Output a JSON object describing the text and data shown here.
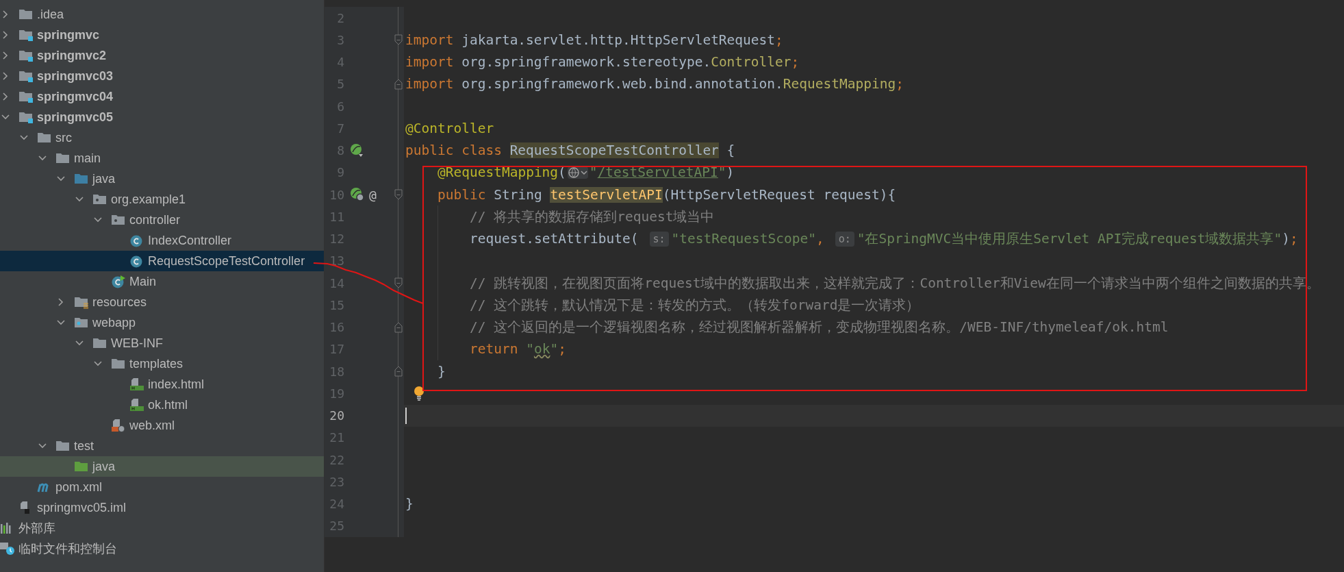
{
  "project_tree": {
    "items": [
      {
        "kind": "folder",
        "label": ".idea",
        "expanded": false,
        "selected": false,
        "highlighted": false
      },
      {
        "kind": "module",
        "label": "springmvc",
        "expanded": false,
        "selected": false,
        "highlighted": false
      },
      {
        "kind": "module",
        "label": "springmvc2",
        "expanded": false,
        "selected": false,
        "highlighted": false
      },
      {
        "kind": "module",
        "label": "springmvc03",
        "expanded": false,
        "selected": false,
        "highlighted": false
      },
      {
        "kind": "module",
        "label": "springmvc04",
        "expanded": false,
        "selected": false,
        "highlighted": false
      },
      {
        "kind": "module",
        "label": "springmvc05",
        "expanded": true,
        "selected": false,
        "highlighted": false,
        "children": [
          {
            "kind": "folder",
            "label": "src",
            "expanded": true,
            "selected": false,
            "highlighted": false,
            "children": [
              {
                "kind": "folder",
                "label": "main",
                "expanded": true,
                "selected": false,
                "highlighted": false,
                "children": [
                  {
                    "kind": "source-folder",
                    "label": "java",
                    "expanded": true,
                    "selected": false,
                    "highlighted": false,
                    "children": [
                      {
                        "kind": "package",
                        "label": "org.example1",
                        "expanded": true,
                        "selected": false,
                        "highlighted": false,
                        "children": [
                          {
                            "kind": "package",
                            "label": "controller",
                            "expanded": true,
                            "selected": false,
                            "highlighted": false,
                            "children": [
                              {
                                "kind": "class",
                                "label": "IndexController",
                                "selected": false,
                                "highlighted": false
                              },
                              {
                                "kind": "class",
                                "label": "RequestScopeTestController",
                                "selected": true,
                                "highlighted": false
                              }
                            ]
                          },
                          {
                            "kind": "main-class",
                            "label": "Main",
                            "selected": false,
                            "highlighted": false
                          }
                        ]
                      }
                    ]
                  },
                  {
                    "kind": "resources-folder",
                    "label": "resources",
                    "expanded": false,
                    "selected": false,
                    "highlighted": false
                  },
                  {
                    "kind": "web-folder",
                    "label": "webapp",
                    "expanded": true,
                    "selected": false,
                    "highlighted": false,
                    "children": [
                      {
                        "kind": "folder",
                        "label": "WEB-INF",
                        "expanded": true,
                        "selected": false,
                        "highlighted": false,
                        "children": [
                          {
                            "kind": "folder",
                            "label": "templates",
                            "expanded": true,
                            "selected": false,
                            "highlighted": false,
                            "children": [
                              {
                                "kind": "html",
                                "label": "index.html",
                                "selected": false,
                                "highlighted": false
                              },
                              {
                                "kind": "html",
                                "label": "ok.html",
                                "selected": false,
                                "highlighted": false
                              }
                            ]
                          },
                          {
                            "kind": "web-xml",
                            "label": "web.xml",
                            "selected": false,
                            "highlighted": false
                          }
                        ]
                      }
                    ]
                  }
                ]
              },
              {
                "kind": "folder",
                "label": "test",
                "expanded": true,
                "selected": false,
                "highlighted": false,
                "children": [
                  {
                    "kind": "test-folder",
                    "label": "java",
                    "selected": false,
                    "highlighted": true
                  }
                ]
              }
            ]
          },
          {
            "kind": "maven",
            "label": "pom.xml",
            "selected": false,
            "highlighted": false
          }
        ]
      },
      {
        "kind": "iml",
        "label": "springmvc05.iml",
        "selected": false,
        "highlighted": false
      },
      {
        "kind": "libraries",
        "label": "外部库",
        "selected": false,
        "highlighted": false
      },
      {
        "kind": "scratches",
        "label": "临时文件和控制台",
        "selected": false,
        "highlighted": false
      }
    ]
  },
  "editor": {
    "lines": [
      {
        "number": "2",
        "current": false
      },
      {
        "number": "3",
        "current": false,
        "gutter": [
          {
            "kind": "fold-start"
          }
        ],
        "tokens": [
          {
            "kind": "kw",
            "text": "import"
          },
          {
            "kind": "plain",
            "text": " jakarta.servlet.http.HttpServletRequest"
          },
          {
            "kind": "semi",
            "text": ";"
          }
        ]
      },
      {
        "number": "4",
        "current": false,
        "tokens": [
          {
            "kind": "kw",
            "text": "import"
          },
          {
            "kind": "plain",
            "text": " org.springframework.stereotype."
          },
          {
            "kind": "cls",
            "text": "Controller"
          },
          {
            "kind": "semi",
            "text": ";"
          }
        ]
      },
      {
        "number": "5",
        "current": false,
        "gutter": [
          {
            "kind": "fold-end"
          }
        ],
        "tokens": [
          {
            "kind": "kw",
            "text": "import"
          },
          {
            "kind": "plain",
            "text": " org.springframework.web.bind.annotation."
          },
          {
            "kind": "cls",
            "text": "RequestMapping"
          },
          {
            "kind": "semi",
            "text": ";"
          }
        ]
      },
      {
        "number": "6",
        "current": false
      },
      {
        "number": "7",
        "current": false,
        "tokens": [
          {
            "kind": "ann",
            "text": "@Controller"
          }
        ]
      },
      {
        "number": "8",
        "current": false,
        "gutter": [
          {
            "kind": "bean"
          }
        ],
        "tokens": [
          {
            "kind": "kw",
            "text": "public class "
          },
          {
            "kind": "usage",
            "text": "RequestScopeTestController"
          },
          {
            "kind": "plain",
            "text": " {"
          }
        ]
      },
      {
        "number": "9",
        "current": false,
        "tokens": [
          {
            "kind": "indent"
          },
          {
            "kind": "ann",
            "text": "@RequestMapping"
          },
          {
            "kind": "plain",
            "text": "("
          },
          {
            "kind": "globe"
          },
          {
            "kind": "str",
            "text": "\""
          },
          {
            "kind": "url",
            "text": "/testServletAPI"
          },
          {
            "kind": "str",
            "text": "\""
          },
          {
            "kind": "plain",
            "text": ")"
          }
        ]
      },
      {
        "number": "10",
        "current": false,
        "gutter": [
          {
            "kind": "bean-web"
          },
          {
            "kind": "symbol",
            "text": "@"
          },
          {
            "kind": "fold-start"
          }
        ],
        "tokens": [
          {
            "kind": "indent"
          },
          {
            "kind": "kw",
            "text": "public "
          },
          {
            "kind": "plain",
            "text": "String "
          },
          {
            "kind": "decl",
            "text": "testServletAPI"
          },
          {
            "kind": "plain",
            "text": "(HttpServletRequest request){"
          }
        ]
      },
      {
        "number": "11",
        "current": false,
        "tokens": [
          {
            "kind": "indent"
          },
          {
            "kind": "indent-guide"
          },
          {
            "kind": "cmt",
            "text": "// 将共享的数据存储到request域当中"
          }
        ]
      },
      {
        "number": "12",
        "current": false,
        "tokens": [
          {
            "kind": "indent"
          },
          {
            "kind": "indent-guide"
          },
          {
            "kind": "plain",
            "text": "request.setAttribute("
          },
          {
            "kind": "hint",
            "text": "s:"
          },
          {
            "kind": "str",
            "text": "\"testRequestScope\""
          },
          {
            "kind": "semi",
            "text": ","
          },
          {
            "kind": "hint",
            "text": "o:"
          },
          {
            "kind": "str",
            "text": "\"在SpringMVC当中使用原生Servlet API完成request域数据共享\""
          },
          {
            "kind": "plain",
            "text": ")"
          },
          {
            "kind": "semi",
            "text": ";"
          }
        ]
      },
      {
        "number": "13",
        "current": false,
        "tokens": [
          {
            "kind": "indent"
          },
          {
            "kind": "indent-guide"
          }
        ]
      },
      {
        "number": "14",
        "current": false,
        "gutter": [
          {
            "kind": "fold-start"
          }
        ],
        "tokens": [
          {
            "kind": "indent"
          },
          {
            "kind": "indent-guide"
          },
          {
            "kind": "cmt",
            "text": "// 跳转视图，在视图页面将request域中的数据取出来，这样就完成了：Controller和View在同一个请求当中两个组件之间数据的共享。"
          }
        ]
      },
      {
        "number": "15",
        "current": false,
        "tokens": [
          {
            "kind": "indent"
          },
          {
            "kind": "indent-guide"
          },
          {
            "kind": "cmt",
            "text": "// 这个跳转，默认情况下是：转发的方式。（转发forward是一次请求）"
          }
        ]
      },
      {
        "number": "16",
        "current": false,
        "gutter": [
          {
            "kind": "fold-end"
          }
        ],
        "tokens": [
          {
            "kind": "indent"
          },
          {
            "kind": "indent-guide"
          },
          {
            "kind": "cmt",
            "text": "// 这个返回的是一个逻辑视图名称，经过视图解析器解析，变成物理视图名称。/WEB-INF/thymeleaf/ok.html"
          }
        ]
      },
      {
        "number": "17",
        "current": false,
        "tokens": [
          {
            "kind": "indent"
          },
          {
            "kind": "indent-guide"
          },
          {
            "kind": "kw",
            "text": "return "
          },
          {
            "kind": "str",
            "text": "\""
          },
          {
            "kind": "typo",
            "text": "ok"
          },
          {
            "kind": "str",
            "text": "\""
          },
          {
            "kind": "semi",
            "text": ";"
          }
        ]
      },
      {
        "number": "18",
        "current": false,
        "gutter": [
          {
            "kind": "fold-end"
          }
        ],
        "tokens": [
          {
            "kind": "indent"
          },
          {
            "kind": "plain",
            "text": "}"
          }
        ]
      },
      {
        "number": "19",
        "current": false,
        "intention": true
      },
      {
        "number": "20",
        "current": true
      },
      {
        "number": "21",
        "current": false
      },
      {
        "number": "22",
        "current": false
      },
      {
        "number": "23",
        "current": false
      },
      {
        "number": "24",
        "current": false,
        "tokens": [
          {
            "kind": "plain",
            "text": "}"
          }
        ]
      },
      {
        "number": "25",
        "current": false
      }
    ]
  }
}
